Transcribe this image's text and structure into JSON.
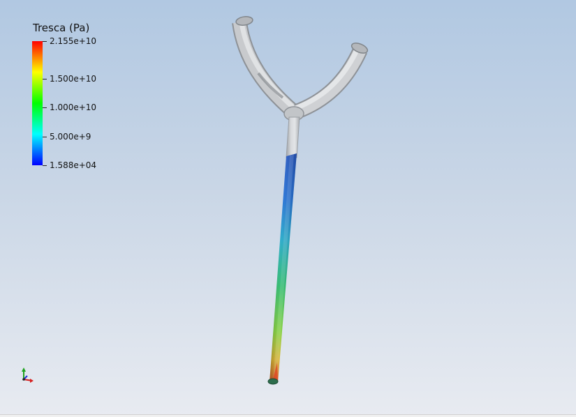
{
  "legend": {
    "title": "Tresca (Pa)",
    "ticks": [
      {
        "label": "2.155e+10",
        "value": 21550000000
      },
      {
        "label": "1.500e+10",
        "value": 15000000000
      },
      {
        "label": "1.000e+10",
        "value": 10000000000
      },
      {
        "label": "5.000e+9",
        "value": 5000000000
      },
      {
        "label": "1.588e+04",
        "value": 15880
      }
    ],
    "range": [
      15880,
      21550000000
    ],
    "colormap": [
      "#0000ff",
      "#00ffff",
      "#00ff00",
      "#ffff00",
      "#ff0000"
    ]
  },
  "model": {
    "name": "y-shaped-tube",
    "base_color": "#c9cbcd",
    "result_colors": [
      "#1f5fd8",
      "#16a8b8",
      "#39c23d",
      "#c7d52b",
      "#e06a1c"
    ]
  },
  "axes": {
    "x_color": "#d62020",
    "y_color": "#1fa21f",
    "z_color": "#2030d8"
  }
}
